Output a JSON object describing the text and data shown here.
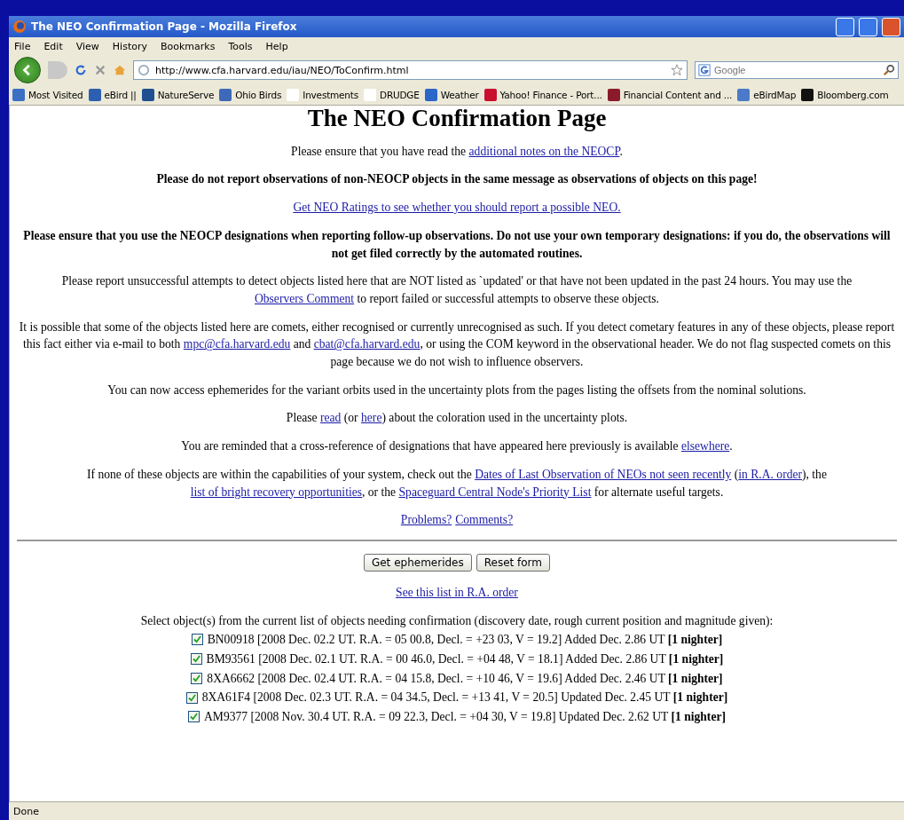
{
  "window": {
    "title": "The NEO Confirmation Page - Mozilla Firefox"
  },
  "menu": [
    "File",
    "Edit",
    "View",
    "History",
    "Bookmarks",
    "Tools",
    "Help"
  ],
  "address": {
    "value": "http://www.cfa.harvard.edu/iau/NEO/ToConfirm.html"
  },
  "search": {
    "placeholder": "Google"
  },
  "bookmarks": [
    {
      "label": "Most Visited",
      "color": "#3a6fc4"
    },
    {
      "label": "eBird ||",
      "color": "#2d5fb0"
    },
    {
      "label": "NatureServe",
      "color": "#1f4f8f"
    },
    {
      "label": "Ohio Birds",
      "color": "#3d6ab8"
    },
    {
      "label": "Investments",
      "color": "#ffffff"
    },
    {
      "label": "DRUDGE",
      "color": "#ffffff"
    },
    {
      "label": "Weather",
      "color": "#2b66c9"
    },
    {
      "label": "Yahoo! Finance - Port...",
      "color": "#c8102e"
    },
    {
      "label": "Financial Content and ...",
      "color": "#8b1a2b"
    },
    {
      "label": "eBirdMap",
      "color": "#4a7ac8"
    },
    {
      "label": "Bloomberg.com",
      "color": "#111111"
    }
  ],
  "page": {
    "heading": "The NEO Confirmation Page",
    "paragraphs": [
      {
        "kind": "plain",
        "segments": [
          "Please ensure that you have read the ",
          {
            "link": "additional notes on the NEOCP"
          },
          "."
        ]
      },
      {
        "kind": "warning",
        "segments": [
          "Please do not report observations of non-NEOCP objects in the same message as observations of objects on this page!"
        ]
      },
      {
        "kind": "plain",
        "segments": [
          {
            "link": "Get NEO Ratings to see whether you should report a possible NEO."
          }
        ]
      },
      {
        "kind": "warning",
        "segments": [
          "Please ensure that you use the NEOCP designations when reporting follow-up observations. Do not use your own temporary designations: if you do, the observations will not get filed correctly by the automated routines."
        ]
      },
      {
        "kind": "plain",
        "segments": [
          "Please report unsuccessful attempts to detect objects listed here that are NOT listed as `updated' or that have not been updated in the past 24 hours. You may use the ",
          {
            "link": "Observers Comment"
          },
          " to report failed or successful attempts to observe these objects."
        ]
      },
      {
        "kind": "plain",
        "segments": [
          "It is possible that some of the objects listed here are comets, either recognised or currently unrecognised as such. If you detect cometary features in any of these objects, please report this fact either via e-mail to both ",
          {
            "link": "mpc@cfa.harvard.edu"
          },
          " and ",
          {
            "link": "cbat@cfa.harvard.edu"
          },
          ", or using the COM keyword in the observational header. We do not flag suspected comets on this page because we do not wish to influence observers."
        ]
      },
      {
        "kind": "plain",
        "segments": [
          "You can now access ephemerides for the variant orbits used in the uncertainty plots from the pages listing the offsets from the nominal solutions."
        ]
      },
      {
        "kind": "plain",
        "segments": [
          "Please ",
          {
            "link": "read"
          },
          " (or ",
          {
            "link": "here"
          },
          ") about the coloration used in the uncertainty plots."
        ]
      },
      {
        "kind": "plain",
        "segments": [
          "You are reminded that a cross-reference of designations that have appeared here previously is available ",
          {
            "link": "elsewhere"
          },
          "."
        ]
      },
      {
        "kind": "plain",
        "segments": [
          "If none of these objects are within the capabilities of your system, check out the ",
          {
            "link": "Dates of Last Observation of NEOs not seen recently"
          },
          " (",
          {
            "link": "in R.A. order"
          },
          "), the ",
          {
            "link": "list of bright recovery opportunities"
          },
          ", or the ",
          {
            "link": "Spaceguard Central Node's Priority List"
          },
          " for alternate useful targets."
        ]
      },
      {
        "kind": "plain",
        "segments": [
          {
            "link": "Problems?"
          },
          {
            "link": "Comments?"
          }
        ]
      }
    ],
    "buttons": [
      "Get ephemerides",
      "Reset form"
    ],
    "ra_link": "See this list in R.A. order",
    "select_intro": "Select object(s) from the current list of objects needing confirmation (discovery date, rough current position and magnitude given):",
    "objects": [
      {
        "checked": true,
        "text": "BN00918 [2008 Dec. 02.2 UT. R.A. = 05 00.8, Decl. = +23 03, V = 19.2] Added Dec. 2.86 UT **[1 nighter]**"
      },
      {
        "checked": true,
        "text": "BM93561 [2008 Dec. 02.1 UT. R.A. = 00 46.0, Decl. = +04 48, V = 18.1] Added Dec. 2.86 UT **[1 nighter]**"
      },
      {
        "checked": true,
        "text": "8XA6662 [2008 Dec. 02.4 UT. R.A. = 04 15.8, Decl. = +10 46, V = 19.6] Added Dec. 2.46 UT **[1 nighter]**"
      },
      {
        "checked": true,
        "text": "8XA61F4 [2008 Dec. 02.3 UT. R.A. = 04 34.5, Decl. = +13 41, V = 20.5] Updated Dec. 2.45 UT **[1 nighter]**"
      },
      {
        "checked": true,
        "text": "AM9377 [2008 Nov. 30.4 UT. R.A. = 09 22.3, Decl. = +04 30, V = 19.8] Updated Dec. 2.62 UT **[1 nighter]**"
      }
    ]
  },
  "status_bar": {
    "text": "Done"
  }
}
